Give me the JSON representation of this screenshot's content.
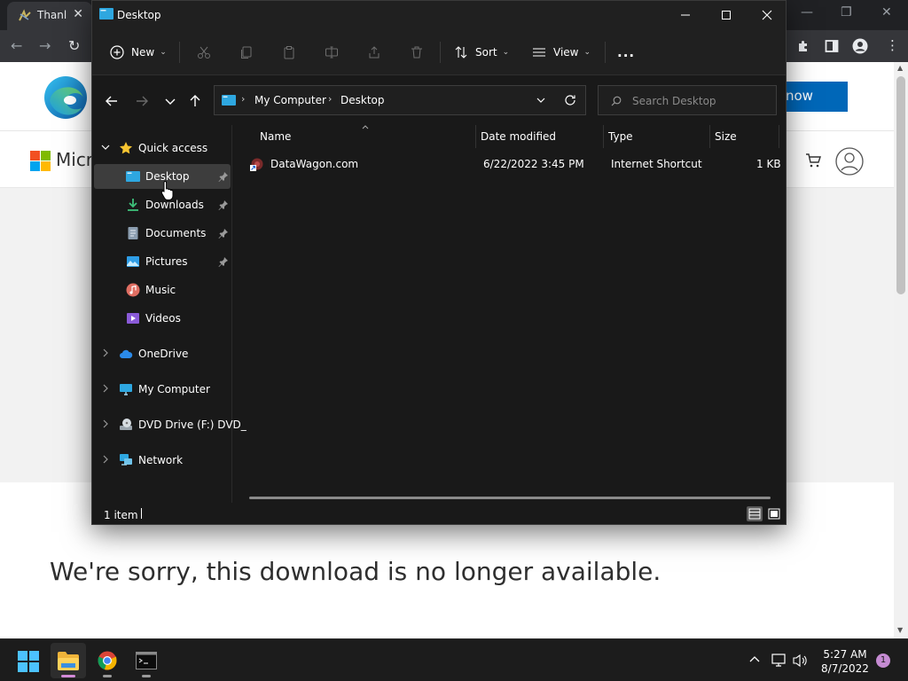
{
  "browser": {
    "tab_title": "Thanl",
    "header_button": "now",
    "ms_brand_partial": "Micr",
    "message": "We're sorry, this download is no longer available.",
    "colors": {
      "brand_blue": "#0067b8",
      "toolbar": "#35363a",
      "tabstrip": "#202124"
    }
  },
  "explorer": {
    "title": "Desktop",
    "commands": {
      "new": "New",
      "sort": "Sort",
      "view": "View",
      "more": "..."
    },
    "address": {
      "segments": [
        "My Computer",
        "Desktop"
      ]
    },
    "search": {
      "placeholder": "Search Desktop"
    },
    "nav": {
      "quick_access": "Quick access",
      "items": [
        {
          "label": "Desktop",
          "icon": "desktop-folder-icon",
          "pinned": true,
          "selected": true
        },
        {
          "label": "Downloads",
          "icon": "downloads-folder-icon",
          "pinned": true
        },
        {
          "label": "Documents",
          "icon": "documents-folder-icon",
          "pinned": true
        },
        {
          "label": "Pictures",
          "icon": "pictures-folder-icon",
          "pinned": true
        },
        {
          "label": "Music",
          "icon": "music-folder-icon"
        },
        {
          "label": "Videos",
          "icon": "videos-folder-icon"
        }
      ],
      "roots": [
        {
          "label": "OneDrive",
          "icon": "onedrive-cloud-icon"
        },
        {
          "label": "My Computer",
          "icon": "computer-icon"
        },
        {
          "label": "DVD Drive (F:) DVD_",
          "icon": "dvd-drive-icon"
        },
        {
          "label": "Network",
          "icon": "network-icon"
        }
      ]
    },
    "columns": [
      "Name",
      "Date modified",
      "Type",
      "Size"
    ],
    "files": [
      {
        "name": "DataWagon.com",
        "date": "6/22/2022 3:45 PM",
        "type": "Internet Shortcut",
        "size": "1 KB"
      }
    ],
    "status": "1 item"
  },
  "taskbar": {
    "apps": [
      {
        "name": "start-button",
        "icon": "windows-logo-icon"
      },
      {
        "name": "file-explorer",
        "icon": "folder-icon",
        "active": true
      },
      {
        "name": "chrome",
        "icon": "chrome-icon"
      },
      {
        "name": "terminal",
        "icon": "terminal-icon"
      }
    ],
    "time": "5:27 AM",
    "date": "8/7/2022",
    "notification_count": "1"
  }
}
